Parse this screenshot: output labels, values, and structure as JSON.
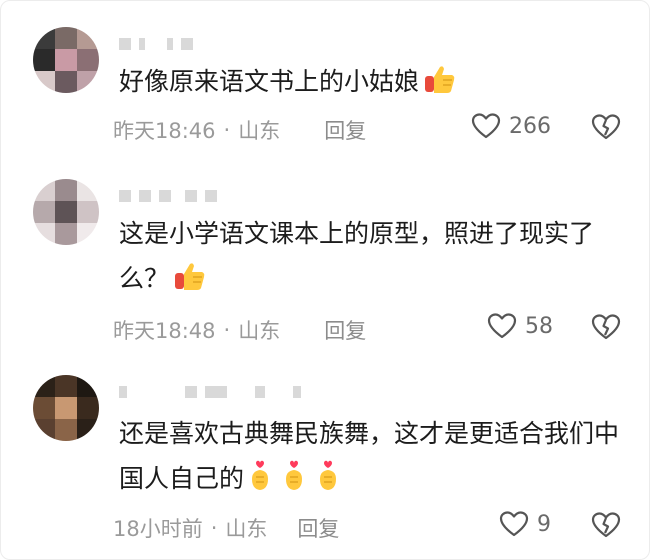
{
  "comments": [
    {
      "text": "好像原来语文书上的小姑娘",
      "emoji": "thumbs-up",
      "time": "昨天18:46",
      "location": "山东",
      "reply_label": "回复",
      "likes": "266"
    },
    {
      "text": "这是小学语文课本上的原型，照进了现实了么？",
      "emoji": "thumbs-up",
      "time": "昨天18:48",
      "location": "山东",
      "reply_label": "回复",
      "likes": "58"
    },
    {
      "text": "还是喜欢古典舞民族舞，这才是更适合我们中国人自己的",
      "emoji": "finger-heart x3",
      "time": "18小时前",
      "location": "山东",
      "reply_label": "回复",
      "likes": "9"
    }
  ],
  "meta_separator": "·",
  "icons": {
    "like": "heart-outline-icon",
    "dislike": "broken-heart-outline-icon"
  },
  "colors": {
    "text": "#1c1c1c",
    "meta": "#9a9a9a",
    "icon": "#555555"
  }
}
